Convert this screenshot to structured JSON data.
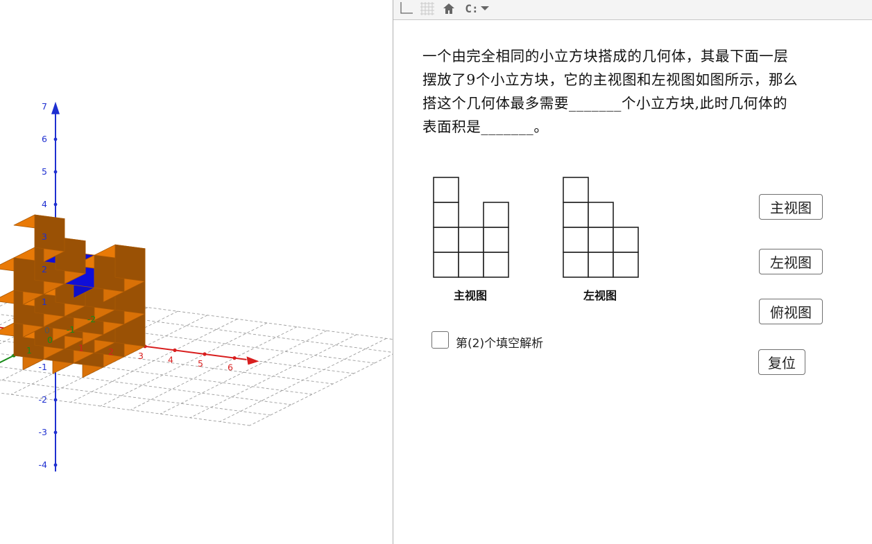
{
  "toolbar": {
    "icons": [
      "axes-icon",
      "grid-icon",
      "home-icon",
      "view-dropdown-icon"
    ],
    "view_icon_label": "C:"
  },
  "axes": {
    "z_ticks": [
      "7",
      "6",
      "5",
      "4",
      "3",
      "2",
      "1",
      "-1",
      "-2",
      "-3",
      "-4"
    ],
    "x_ticks": [
      "1",
      "2",
      "3",
      "4",
      "5",
      "6"
    ],
    "y_ticks": [
      "-1",
      "-2",
      "0",
      "1"
    ],
    "origin_label": "0",
    "colors": {
      "x": "#d81e1e",
      "y": "#178a17",
      "z": "#1e2fd0"
    }
  },
  "cubes": {
    "main_color": "#e97a07",
    "highlight_color": "#0f0fd8"
  },
  "question": {
    "line1": "一个由完全相同的小立方块搭成的几何体，其最下面一层",
    "line2": "摆放了9个小立方块，它的主视图和左视图如图所示，那么",
    "line3": "搭这个几何体最多需要_______个小立方块,此时几何体的",
    "line4": "表面积是_______。"
  },
  "views": {
    "front_caption": "主视图",
    "left_caption": "左视图"
  },
  "checkbox": {
    "label": "第(2)个填空解析",
    "checked": false
  },
  "buttons": {
    "front": "主视图",
    "left": "左视图",
    "top": "俯视图",
    "reset": "复位"
  }
}
